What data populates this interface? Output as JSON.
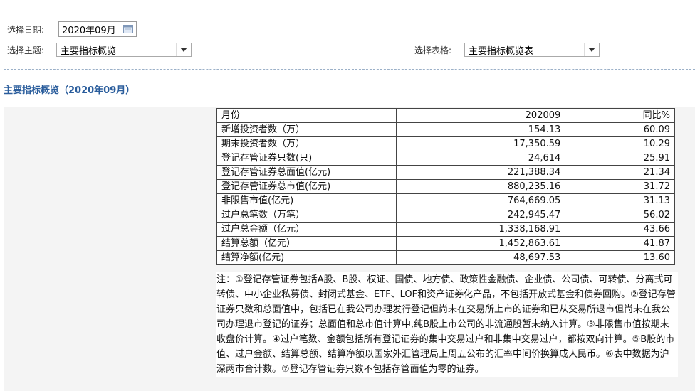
{
  "filters": {
    "date_label": "选择日期:",
    "date_value": "2020年09月",
    "theme_label": "选择主题:",
    "theme_value": "主要指标概览",
    "table_label": "选择表格:",
    "table_value": "主要指标概览表"
  },
  "section_title": "主要指标概览（2020年09月）",
  "table": {
    "headers": [
      "月份",
      "202009",
      "同比%"
    ],
    "rows": [
      [
        "新增投资者数（万）",
        "154.13",
        "60.09"
      ],
      [
        "期末投资者数（万）",
        "17,350.59",
        "10.29"
      ],
      [
        "登记存管证券只数(只)",
        "24,614",
        "25.91"
      ],
      [
        "登记存管证券总面值(亿元)",
        "221,388.34",
        "21.34"
      ],
      [
        "登记存管证券总市值(亿元)",
        "880,235.16",
        "31.72"
      ],
      [
        "非限售市值(亿元)",
        "764,669.05",
        "31.13"
      ],
      [
        "过户总笔数（万笔）",
        "242,945.47",
        "56.02"
      ],
      [
        "过户总金额（亿元）",
        "1,338,168.91",
        "43.66"
      ],
      [
        "结算总额（亿元）",
        "1,452,863.61",
        "41.87"
      ],
      [
        "结算净额(亿元)",
        "48,697.53",
        "13.60"
      ]
    ]
  },
  "note": "注：①登记存管证券包括A股、B股、权证、国债、地方债、政策性金融债、企业债、公司债、可转债、分离式可转债、中小企业私募债、封闭式基金、ETF、LOF和资产证券化产品，不包括开放式基金和债券回购。②登记存管证券只数和总面值中，包括已在我公司办理发行登记但尚未在交易所上市的证券和已从交易所退市但尚未在我公司办理退市登记的证券；总面值和总市值计算中,纯B股上市公司的非流通股暂未纳入计算。③非限售市值按期末收盘价计算。④过户笔数、金额包括所有登记证券的集中交易过户和非集中交易过户，都按双向计算。⑤B股的市值、过户金额、结算总额、结算净额以国家外汇管理局上周五公布的汇率中间价换算成人民币。⑥表中数据为沪深两市合计数。⑦登记存管证券只数不包括存管面值为零的证券。",
  "icons": {
    "calendar": "calendar-icon",
    "dropdown": "chevron-down-icon"
  }
}
